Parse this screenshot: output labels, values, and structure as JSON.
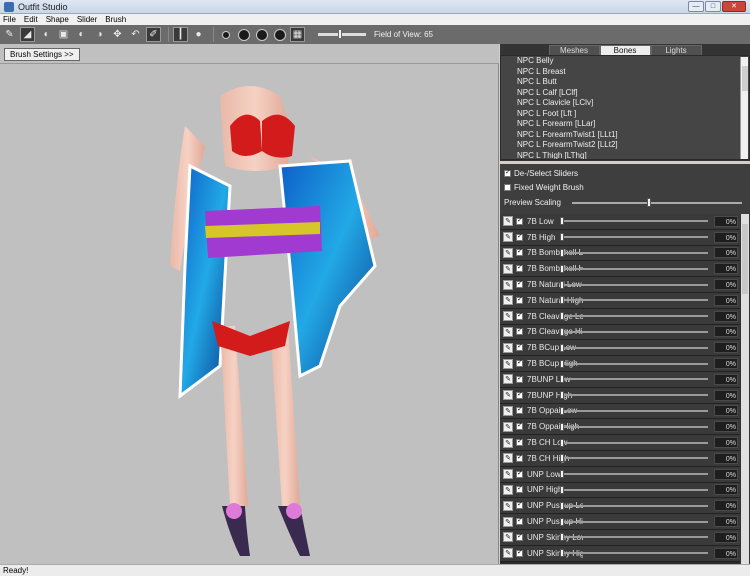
{
  "window": {
    "title": "Outfit Studio"
  },
  "menu": [
    "File",
    "Edit",
    "Shape",
    "Slider",
    "Brush"
  ],
  "toolbar": {
    "fov_label": "Field of View: 65"
  },
  "brush_settings_label": "Brush Settings >>",
  "tabs": [
    "Meshes",
    "Bones",
    "Lights"
  ],
  "bones": [
    "NPC Belly",
    "NPC L Breast",
    "NPC L Butt",
    "NPC L Calf [LClf]",
    "NPC L Clavicle [LClv]",
    "NPC L Foot [Lft ]",
    "NPC L Forearm [LLar]",
    "NPC L ForearmTwist1 [LLt1]",
    "NPC L ForearmTwist2 [LLt2]",
    "NPC L Thigh [LThg]"
  ],
  "options": {
    "deselect_label": "De-/Select Sliders",
    "fixed_weight_label": "Fixed Weight Brush",
    "preview_scaling_label": "Preview Scaling"
  },
  "sliders": [
    {
      "name": "7B Low",
      "value": "0%"
    },
    {
      "name": "7B High",
      "value": "0%"
    },
    {
      "name": "7B Bombshell Low",
      "value": "0%"
    },
    {
      "name": "7B Bombshell High",
      "value": "0%"
    },
    {
      "name": "7B Natural Low",
      "value": "0%"
    },
    {
      "name": "7B Natural High",
      "value": "0%"
    },
    {
      "name": "7B Cleavage Low",
      "value": "0%"
    },
    {
      "name": "7B Cleavage High",
      "value": "0%"
    },
    {
      "name": "7B BCup Low",
      "value": "0%"
    },
    {
      "name": "7B BCup High",
      "value": "0%"
    },
    {
      "name": "7BUNP Low",
      "value": "0%"
    },
    {
      "name": "7BUNP High",
      "value": "0%"
    },
    {
      "name": "7B Oppai Low",
      "value": "0%"
    },
    {
      "name": "7B Oppai High",
      "value": "0%"
    },
    {
      "name": "7B CH Low",
      "value": "0%"
    },
    {
      "name": "7B CH High",
      "value": "0%"
    },
    {
      "name": "UNP Low",
      "value": "0%"
    },
    {
      "name": "UNP High",
      "value": "0%"
    },
    {
      "name": "UNP Pushup Low",
      "value": "0%"
    },
    {
      "name": "UNP Pushup High",
      "value": "0%"
    },
    {
      "name": "UNP Skinny Low",
      "value": "0%"
    },
    {
      "name": "UNP Skinny High",
      "value": "0%"
    }
  ],
  "status": {
    "text": "Ready!"
  }
}
